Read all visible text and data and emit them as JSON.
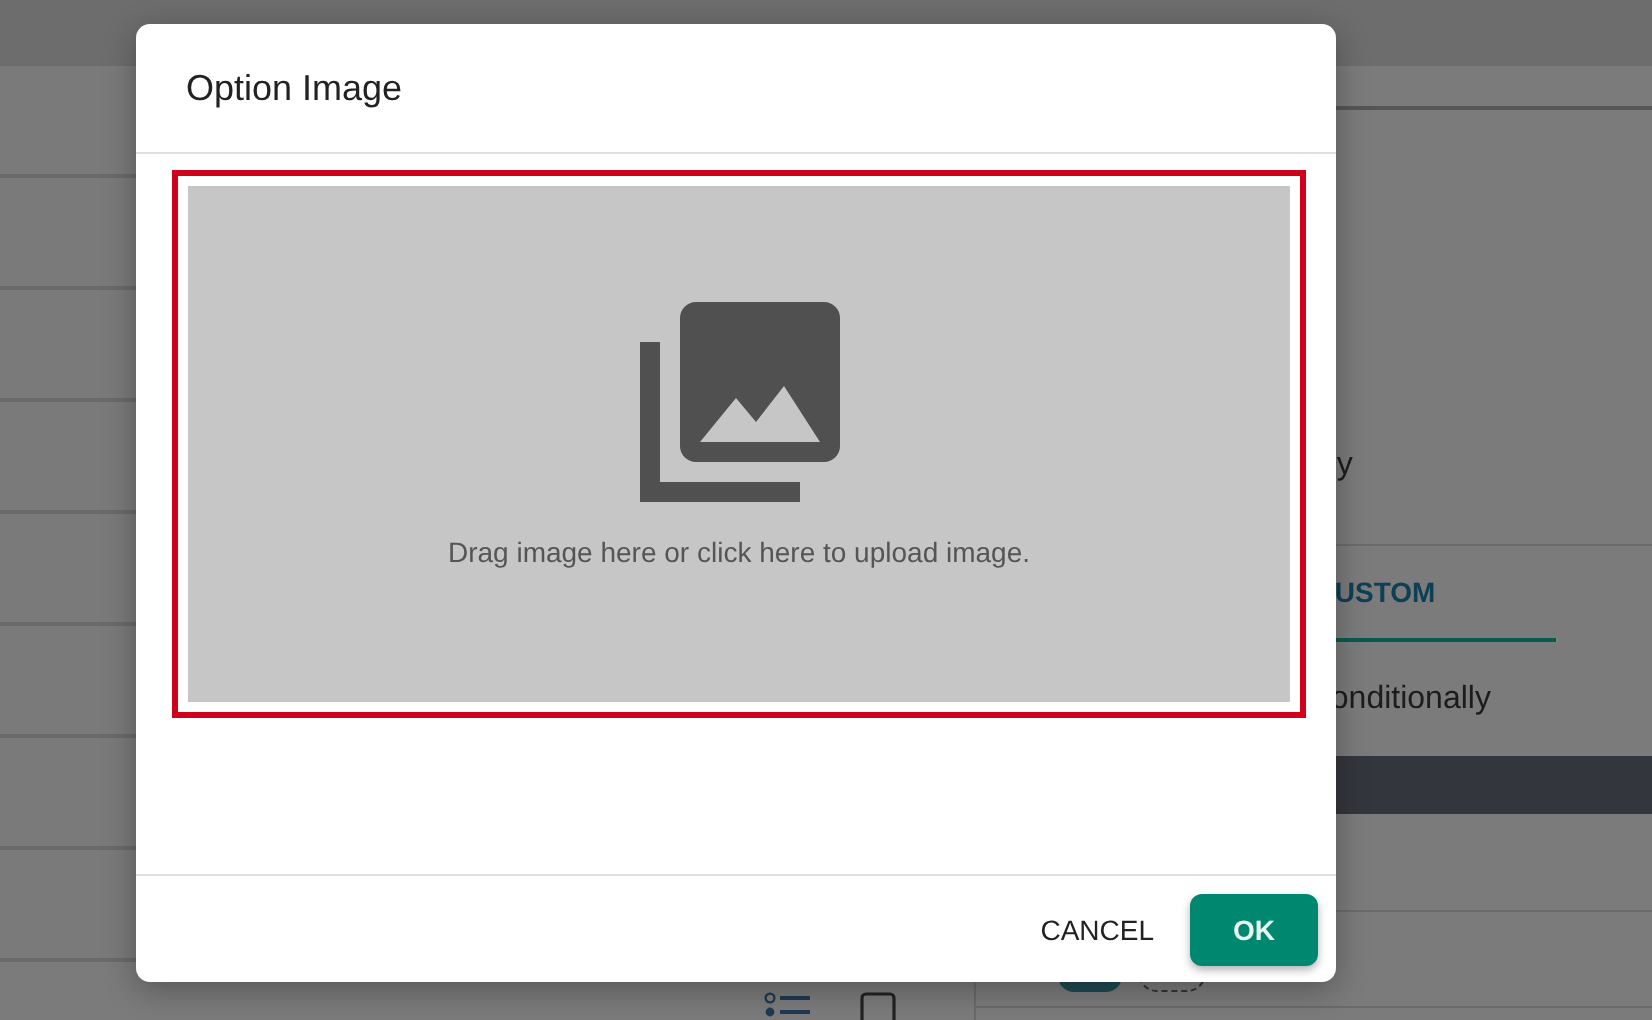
{
  "background": {
    "label_fragment": "y",
    "tab": {
      "label": "USTOM",
      "selected": true
    },
    "option_fragment": "onditionally"
  },
  "dialog": {
    "title": "Option Image",
    "upload_hint": "Drag image here or click here to upload image.",
    "buttons": [
      {
        "label": "CANCEL",
        "kind": "text"
      },
      {
        "label": "OK",
        "kind": "primary"
      }
    ]
  }
}
